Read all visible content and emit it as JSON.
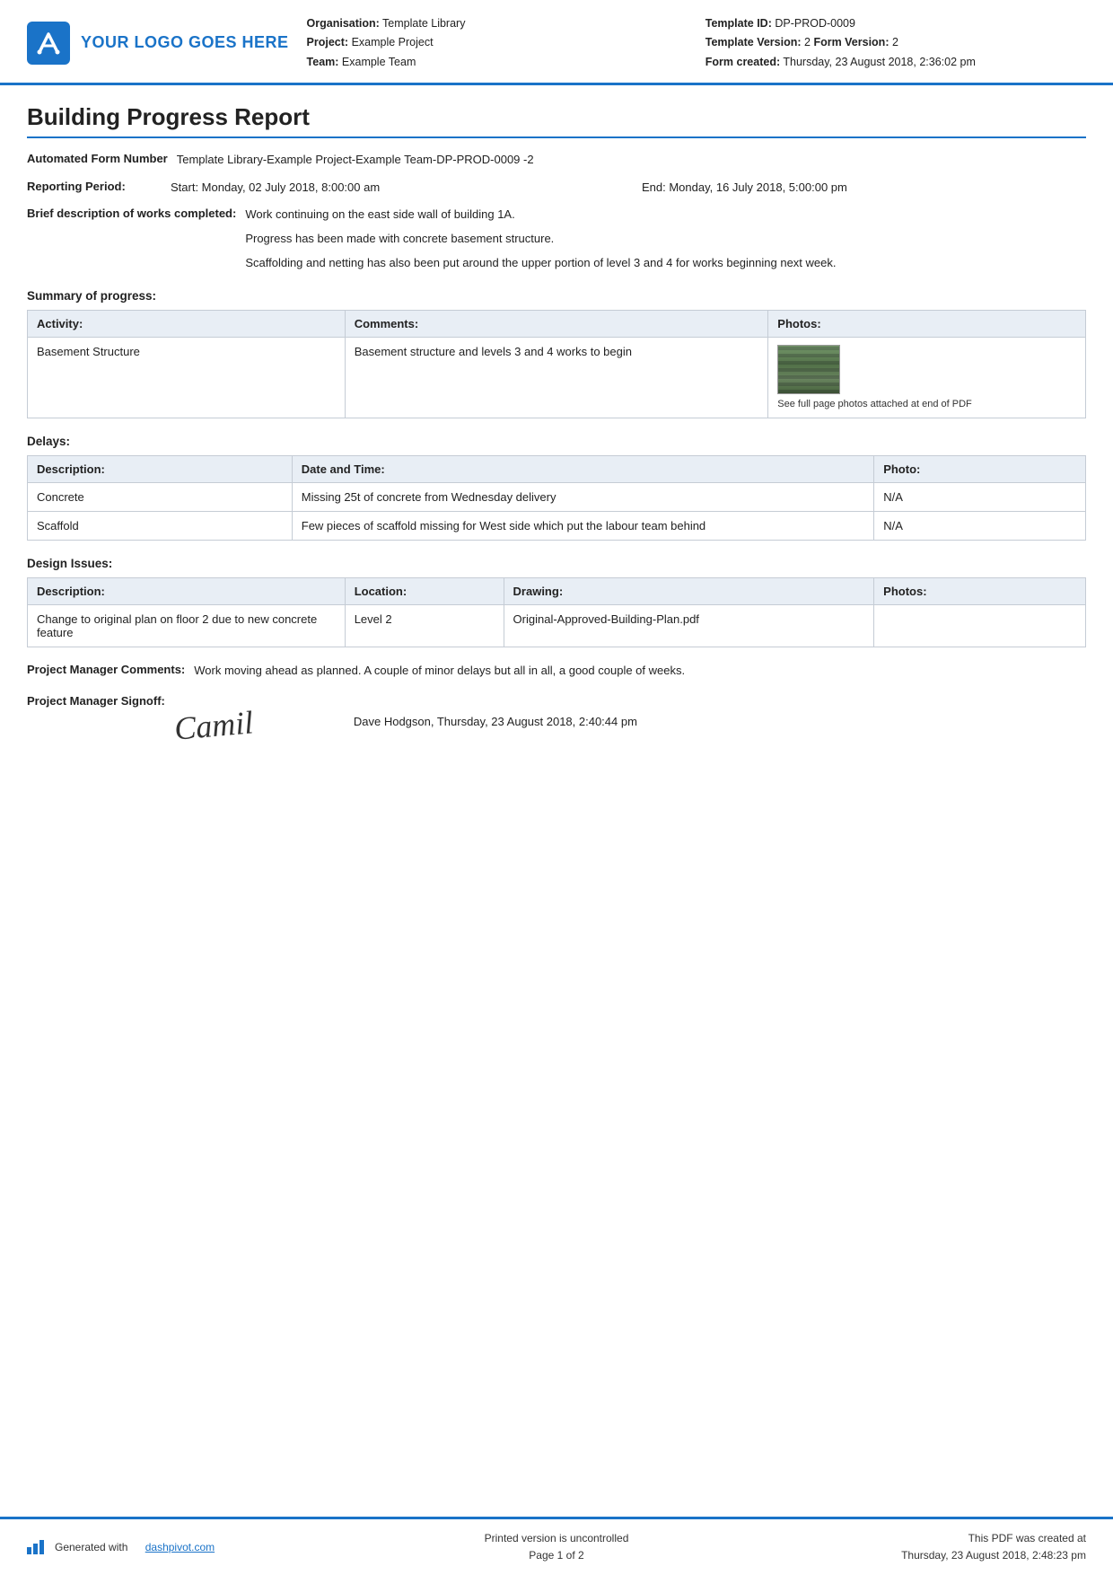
{
  "header": {
    "logo_text": "YOUR LOGO GOES HERE",
    "meta_left": {
      "organisation_label": "Organisation:",
      "organisation_value": "Template Library",
      "project_label": "Project:",
      "project_value": "Example Project",
      "team_label": "Team:",
      "team_value": "Example Team"
    },
    "meta_right": {
      "template_id_label": "Template ID:",
      "template_id_value": "DP-PROD-0009",
      "template_version_label": "Template Version:",
      "template_version_value": "2",
      "form_version_label": "Form Version:",
      "form_version_value": "2",
      "form_created_label": "Form created:",
      "form_created_value": "Thursday, 23 August 2018, 2:36:02 pm"
    }
  },
  "report": {
    "title": "Building Progress Report",
    "form_number_label": "Automated Form Number",
    "form_number_value": "Template Library-Example Project-Example Team-DP-PROD-0009   -2",
    "reporting_period_label": "Reporting Period:",
    "reporting_period_start": "Start: Monday, 02 July 2018, 8:00:00 am",
    "reporting_period_end": "End: Monday, 16 July 2018, 5:00:00 pm",
    "brief_description_label": "Brief description of works completed:",
    "brief_description_lines": [
      "Work continuing on the east side wall of building 1A.",
      "Progress has been made with concrete basement structure.",
      "Scaffolding and netting has also been put around the upper portion of level 3 and 4 for works beginning next week."
    ],
    "summary_section_title": "Summary of progress:",
    "summary_table": {
      "headers": [
        "Activity:",
        "Comments:",
        "Photos:"
      ],
      "rows": [
        {
          "activity": "Basement Structure",
          "comments": "Basement structure and levels 3 and 4 works to begin",
          "photo_caption": "See full page photos attached at end of PDF"
        }
      ]
    },
    "delays_section_title": "Delays:",
    "delays_table": {
      "headers": [
        "Description:",
        "Date and Time:",
        "Photo:"
      ],
      "rows": [
        {
          "description": "Concrete",
          "date_time": "Missing 25t of concrete from Wednesday delivery",
          "photo": "N/A"
        },
        {
          "description": "Scaffold",
          "date_time": "Few pieces of scaffold missing for West side which put the labour team behind",
          "photo": "N/A"
        }
      ]
    },
    "design_issues_section_title": "Design Issues:",
    "design_issues_table": {
      "headers": [
        "Description:",
        "Location:",
        "Drawing:",
        "Photos:"
      ],
      "rows": [
        {
          "description": "Change to original plan on floor 2 due to new concrete feature",
          "location": "Level 2",
          "drawing": "Original-Approved-Building-Plan.pdf",
          "photos": ""
        }
      ]
    },
    "manager_comments_label": "Project Manager Comments:",
    "manager_comments_value": "Work moving ahead as planned. A couple of minor delays but all in all, a good couple of weeks.",
    "manager_signoff_label": "Project Manager Signoff:",
    "signature_text": "Camil",
    "signoff_name_date": "Dave Hodgson, Thursday, 23 August 2018, 2:40:44 pm"
  },
  "footer": {
    "generated_text": "Generated with",
    "dashpivot_link": "dashpivot.com",
    "uncontrolled_text": "Printed version is uncontrolled",
    "page_text": "Page 1 of 2",
    "pdf_created_text": "This PDF was created at",
    "pdf_created_date": "Thursday, 23 August 2018, 2:48:23 pm"
  }
}
